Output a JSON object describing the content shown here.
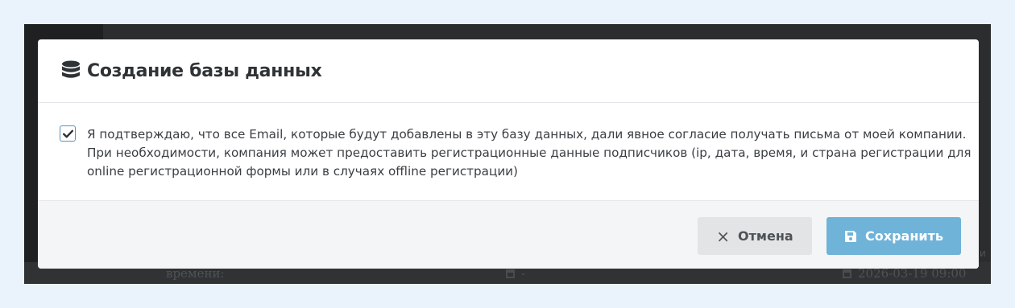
{
  "background": {
    "row_label": "времени:",
    "row_middle_value": "-",
    "row_right_value": "2026-03-19 09:00",
    "right_edge_text": "и"
  },
  "modal": {
    "icon": "database-icon",
    "title": "Создание базы данных",
    "consent": {
      "checked": true,
      "lines": [
        "Я подтверждаю, что все Email, которые будут добавлены в эту базу данных, дали явное согласие получать письма от моей компании.",
        "При необходимости, компания может предоставить регистрационные данные подписчиков (ip, дата, время, и страна регистрации для",
        "online регистрационной формы или в случаях offline регистрации)"
      ]
    },
    "buttons": {
      "cancel_icon": "×",
      "cancel_label": "Отмена",
      "save_icon": "floppy-disk-icon",
      "save_label": "Сохранить"
    }
  },
  "colors": {
    "primary_button": "#6fb3d8",
    "checkbox_border": "#5a8fc2"
  }
}
